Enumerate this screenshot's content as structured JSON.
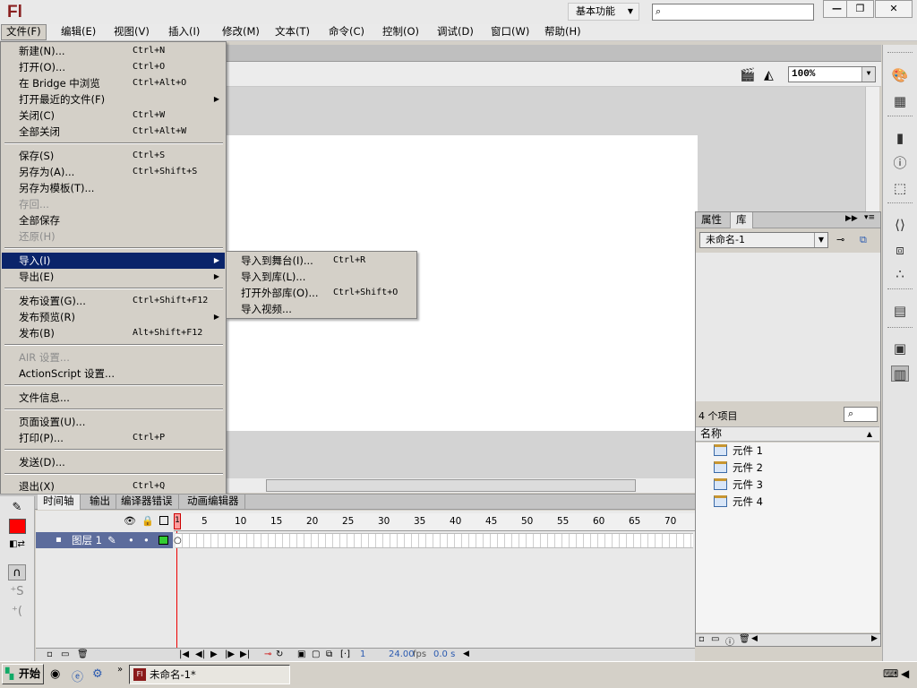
{
  "app": {
    "logo": "Fl",
    "workspace": "基本功能",
    "window_controls": {
      "minimize": "—",
      "restore": "❐",
      "close": "✕"
    }
  },
  "menubar": [
    "文件(F)",
    "编辑(E)",
    "视图(V)",
    "插入(I)",
    "修改(M)",
    "文本(T)",
    "命令(C)",
    "控制(O)",
    "调试(D)",
    "窗口(W)",
    "帮助(H)"
  ],
  "file_menu": [
    {
      "label": "新建(N)...",
      "shortcut": "Ctrl+N"
    },
    {
      "label": "打开(O)...",
      "shortcut": "Ctrl+O"
    },
    {
      "label": "在 Bridge 中浏览",
      "shortcut": "Ctrl+Alt+O"
    },
    {
      "label": "打开最近的文件(F)",
      "shortcut": "",
      "submenu": true
    },
    {
      "label": "关闭(C)",
      "shortcut": "Ctrl+W"
    },
    {
      "label": "全部关闭",
      "shortcut": "Ctrl+Alt+W"
    },
    {
      "label": "保存(S)",
      "shortcut": "Ctrl+S"
    },
    {
      "label": "另存为(A)...",
      "shortcut": "Ctrl+Shift+S"
    },
    {
      "label": "另存为模板(T)...",
      "shortcut": ""
    },
    {
      "label": "存回...",
      "shortcut": "",
      "disabled": true
    },
    {
      "label": "全部保存",
      "shortcut": ""
    },
    {
      "label": "还原(H)",
      "shortcut": "",
      "disabled": true
    },
    {
      "label": "导入(I)",
      "shortcut": "",
      "submenu": true,
      "highlight": true
    },
    {
      "label": "导出(E)",
      "shortcut": "",
      "submenu": true
    },
    {
      "label": "发布设置(G)...",
      "shortcut": "Ctrl+Shift+F12"
    },
    {
      "label": "发布预览(R)",
      "shortcut": "",
      "submenu": true
    },
    {
      "label": "发布(B)",
      "shortcut": "Alt+Shift+F12"
    },
    {
      "label": "AIR 设置...",
      "shortcut": "",
      "disabled": true
    },
    {
      "label": "ActionScript 设置...",
      "shortcut": ""
    },
    {
      "label": "文件信息...",
      "shortcut": ""
    },
    {
      "label": "页面设置(U)...",
      "shortcut": ""
    },
    {
      "label": "打印(P)...",
      "shortcut": "Ctrl+P"
    },
    {
      "label": "发送(D)...",
      "shortcut": ""
    },
    {
      "label": "退出(X)",
      "shortcut": "Ctrl+Q"
    }
  ],
  "import_submenu": [
    {
      "label": "导入到舞台(I)...",
      "shortcut": "Ctrl+R"
    },
    {
      "label": "导入到库(L)...",
      "shortcut": ""
    },
    {
      "label": "打开外部库(O)...",
      "shortcut": "Ctrl+Shift+O"
    },
    {
      "label": "导入视频...",
      "shortcut": ""
    }
  ],
  "toolbar": {
    "zoom": "100%"
  },
  "library": {
    "tabs": [
      "属性",
      "库"
    ],
    "document": "未命名-1",
    "count": "4 个项目",
    "column_name": "名称",
    "items": [
      "元件 1",
      "元件 2",
      "元件 3",
      "元件 4"
    ]
  },
  "timeline": {
    "tabs": [
      "时间轴",
      "输出",
      "编译器错误",
      "动画编辑器"
    ],
    "ruler": [
      "5",
      "10",
      "15",
      "20",
      "25",
      "30",
      "35",
      "40",
      "45",
      "50",
      "55",
      "60",
      "65",
      "70"
    ],
    "current_frame": "1",
    "layer": "图层 1",
    "frame_readout": "1",
    "fps": "24.00",
    "fps_unit": "fps",
    "time": "0.0 s"
  },
  "colors": {
    "stroke": "#000000",
    "fill": "#ff0000",
    "highlight": "#0a246a"
  },
  "taskbar": {
    "start": "开始",
    "task": "未命名-1*"
  }
}
